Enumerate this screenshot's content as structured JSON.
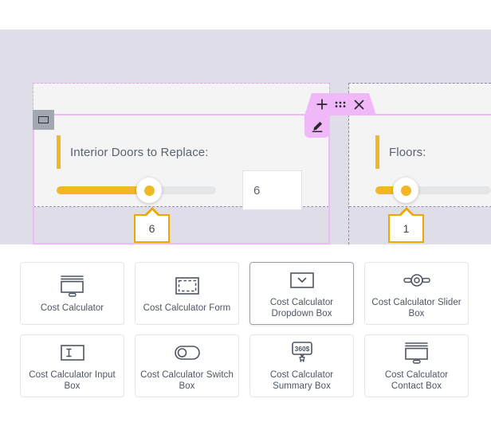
{
  "canvas": {
    "toolbar": {
      "add_icon": "plus-icon",
      "drag_icon": "drag-dots-icon",
      "close_icon": "close-icon",
      "edit_icon": "pencil-edit-icon"
    },
    "section_handle_icon": "column-handle-icon",
    "widgets": [
      {
        "label": "Interior Doors to Replace:",
        "slider_value": "6",
        "slider_percent": 58,
        "input_value": "6"
      },
      {
        "label": "Floors:",
        "slider_value": "1",
        "slider_percent": 14
      }
    ]
  },
  "panel": {
    "cards": [
      {
        "label": "Cost Calculator",
        "icon": "monitor-icon",
        "active": false
      },
      {
        "label": "Cost Calculator Form",
        "icon": "dashed-frame-icon",
        "active": false
      },
      {
        "label": "Cost Calculator Dropdown Box",
        "icon": "dropdown-chevron-icon",
        "active": true
      },
      {
        "label": "Cost Calculator Slider Box",
        "icon": "slider-knob-icon",
        "active": false
      },
      {
        "label": "Cost Calculator Input Box",
        "icon": "text-input-icon",
        "active": false
      },
      {
        "label": "Cost Calculator Switch Box",
        "icon": "toggle-switch-icon",
        "active": false
      },
      {
        "label": "Cost Calculator Summary Box",
        "icon": "price-tag-cart-icon",
        "active": false,
        "icon_text": "360$"
      },
      {
        "label": "Cost Calculator Contact Box",
        "icon": "monitor-icon",
        "active": false
      }
    ]
  },
  "colors": {
    "accent": "#f2b824",
    "toolbar_pink": "#f0b8f8",
    "canvas_bg": "#dedde8",
    "widget_bg": "#f4f4f5"
  }
}
